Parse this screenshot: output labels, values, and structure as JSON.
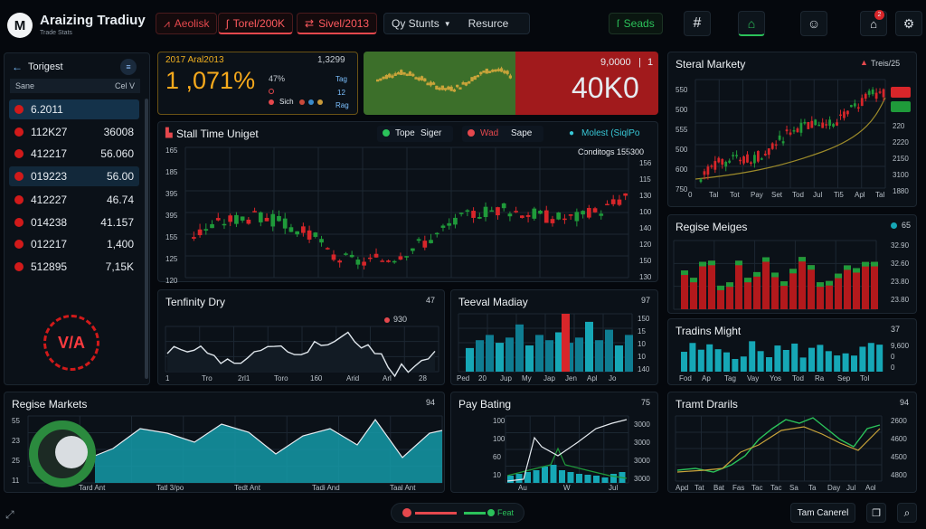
{
  "app": {
    "title": "Araizing Tradiuy",
    "subtitle": "Trade Stats",
    "logo": "M"
  },
  "topbar": {
    "btn1": "Aeolisk",
    "btn2": "Torel/200K",
    "btn3": "Sivel/2013",
    "dropdown": "Qy Stunts",
    "resource": "Resurce",
    "seads": "Seads",
    "badge": "2"
  },
  "sidebar": {
    "title": "Torigest",
    "col1": "Sane",
    "col2": "Cel V",
    "rows": [
      {
        "a": "6.2011",
        "b": ""
      },
      {
        "a": "112K27",
        "b": "36008"
      },
      {
        "a": "412217",
        "b": "56.060"
      },
      {
        "a": "019223",
        "b": "56.00"
      },
      {
        "a": "412227",
        "b": "46.74"
      },
      {
        "a": "014238",
        "b": "41.157"
      },
      {
        "a": "012217",
        "b": "1,400"
      },
      {
        "a": "512895",
        "b": "7,15K"
      }
    ],
    "logo_text": "V/A"
  },
  "stats": {
    "label": "2017 Aral2013",
    "big": "1 ,071%",
    "corner": "1,3299",
    "pct": "47%",
    "l1": "Tag",
    "l2": "12",
    "l3": "Rag",
    "legend": "Sich"
  },
  "hero": {
    "top": "9,0000",
    "sep": "|",
    "n": "1",
    "value": "40K0"
  },
  "main_chart": {
    "title": "Stall Time Uniget",
    "tab1": "Tope",
    "tab2": "Siger",
    "tab3": "Wad",
    "tab4": "Sape",
    "tab5": "Molest (SiqlPo",
    "sub": "Conditogs 155300",
    "yticks": [
      "165",
      "185",
      "395",
      "395",
      "155",
      "125",
      "120"
    ],
    "rticks": [
      "156",
      "115",
      "130",
      "100",
      "140",
      "120",
      "150",
      "130"
    ]
  },
  "small1": {
    "title": "Tenfinity Dry",
    "val": "47",
    "legend": "930",
    "xticks": [
      "1",
      "Tro",
      "2rl1",
      "Toro",
      "160",
      "Arid",
      "Arl",
      "28"
    ]
  },
  "small2": {
    "title": "Teeval Madiay",
    "val": "97",
    "yticks": [
      "150",
      "15",
      "10",
      "10",
      "140"
    ],
    "xticks": [
      "Ped",
      "20",
      "Jup",
      "My",
      "Jap",
      "Jen",
      "Apl",
      "Jo"
    ]
  },
  "right1": {
    "title": "Steral Markety",
    "tag": "Treis/25",
    "yticks": [
      "550",
      "500",
      "555",
      "500",
      "600",
      "750"
    ],
    "rticks": [
      "T83",
      "530",
      "220",
      "2220",
      "2150",
      "3100",
      "1880"
    ],
    "xticks": [
      "0",
      "Tal",
      "Tot",
      "Pay",
      "Set",
      "Tod",
      "Jul",
      "Ti5",
      "Apl",
      "Tal"
    ]
  },
  "right2": {
    "title": "Regise Meiges",
    "val": "65",
    "rticks": [
      "32.90",
      "32.60",
      "23.80",
      "23.80"
    ]
  },
  "right3": {
    "title": "Tradins Might",
    "val": "37",
    "rticks": [
      "9,600",
      "0",
      "0"
    ],
    "xticks": [
      "Fod",
      "Ap",
      "Tag",
      "Vay",
      "Yos",
      "Tod",
      "Ra",
      "Sep",
      "Tol"
    ]
  },
  "bottom1": {
    "title": "Regise Markets",
    "val": "94",
    "yticks": [
      "55",
      "23",
      "25",
      "11"
    ],
    "xticks": [
      "Tard Ant",
      "Tatl 3/po",
      "Tedt Ant",
      "Tadi And",
      "Taal Ant"
    ]
  },
  "bottom2": {
    "title": "Pay Bating",
    "val": "75",
    "yticks": [
      "100",
      "100",
      "60",
      "10"
    ],
    "rticks": [
      "3000",
      "3000",
      "3000",
      "3000"
    ],
    "xticks": [
      "Au",
      "W",
      "Jul"
    ]
  },
  "bottom3": {
    "title": "Tramt Drarils",
    "val": "94",
    "rticks": [
      "2600",
      "4600",
      "4500",
      "4800"
    ],
    "xticks": [
      "Apd",
      "Tat",
      "Bat",
      "Fas",
      "Tac",
      "Tac",
      "Sa",
      "Ta",
      "Day",
      "Jul",
      "Aol"
    ]
  },
  "footer": {
    "feat": "Feat",
    "btn": "Tam Canerel"
  },
  "colors": {
    "green": "#1f9a3a",
    "red": "#d8262a",
    "teal": "#16a7b6",
    "hero_green": "#3c6f2a",
    "hero_red": "#a11a1c"
  }
}
